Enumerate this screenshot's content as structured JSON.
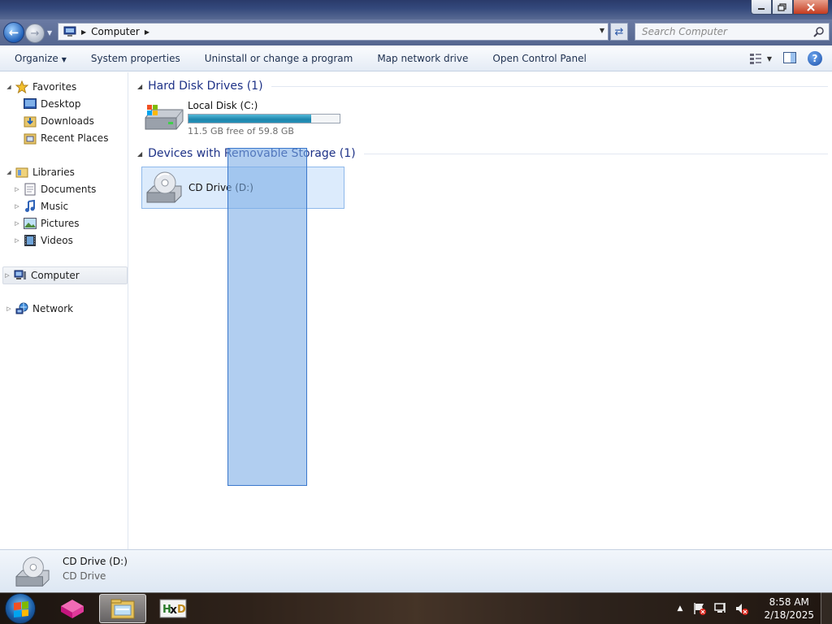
{
  "window": {
    "minimize_icon": "minimize-icon",
    "maximize_icon": "restore-icon",
    "close_icon": "close-icon"
  },
  "navbar": {
    "address_path": "Computer",
    "search_placeholder": "Search Computer"
  },
  "commandbar": {
    "items": [
      "Organize",
      "System properties",
      "Uninstall or change a program",
      "Map network drive",
      "Open Control Panel"
    ]
  },
  "sidebar": {
    "favorites": {
      "label": "Favorites",
      "items": [
        "Desktop",
        "Downloads",
        "Recent Places"
      ]
    },
    "libraries": {
      "label": "Libraries",
      "items": [
        "Documents",
        "Music",
        "Pictures",
        "Videos"
      ]
    },
    "computer": "Computer",
    "network": "Network"
  },
  "content": {
    "hdd_group": "Hard Disk Drives (1)",
    "removable_group": "Devices with Removable Storage (1)",
    "local_disk": {
      "name": "Local Disk (C:)",
      "free_text": "11.5 GB free of 59.8 GB",
      "used_fraction": 0.81
    },
    "cd_drive": {
      "name": "CD Drive (D:)"
    }
  },
  "details": {
    "name": "CD Drive (D:)",
    "type": "CD Drive"
  },
  "taskbar": {
    "time": "8:58 AM",
    "date": "2/18/2025"
  },
  "colors": {
    "group_title": "#1e3287",
    "selection": "#dcebfc",
    "drive_bar": "#26a0da"
  }
}
